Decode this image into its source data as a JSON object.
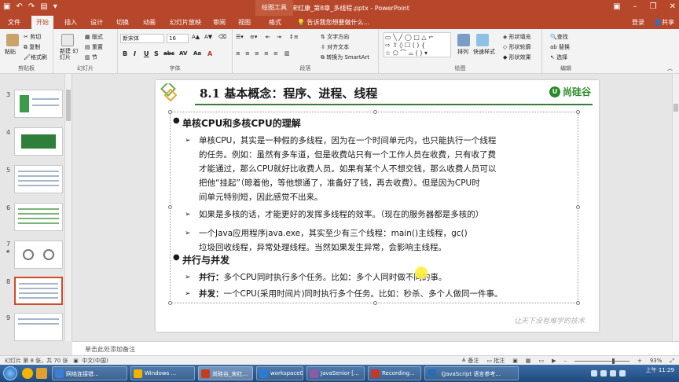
{
  "title_bar": {
    "title": "尚硅谷_宋红康_第8章_多线程.pptx - PowerPoint",
    "drawing_tools": "绘图工具",
    "qa_icons": [
      "save-icon",
      "undo-icon",
      "redo-icon",
      "start-from-beginning-icon",
      "customize-icon"
    ]
  },
  "ribbon_tabs": [
    "文件",
    "开始",
    "插入",
    "设计",
    "切换",
    "动画",
    "幻灯片放映",
    "审阅",
    "视图",
    "格式"
  ],
  "active_tab": "开始",
  "tell_me": "告诉我您想要做什么...",
  "account": {
    "login": "登录",
    "share": "共享"
  },
  "ribbon": {
    "clipboard": {
      "paste": "粘贴",
      "cut": "剪切",
      "copy": "复制",
      "format_painter": "格式刷",
      "label": "剪贴板"
    },
    "slides": {
      "new_slide": "新建\n幻灯片",
      "layout": "版式",
      "reset": "重置",
      "section": "节",
      "label": "幻灯片"
    },
    "font": {
      "name": "新宋体",
      "size": "16",
      "label": "字体",
      "buttons": [
        "B",
        "I",
        "U",
        "S",
        "abc",
        "AV",
        "Aa",
        "A"
      ]
    },
    "paragraph": {
      "text_direction": "文字方向",
      "align_text": "对齐文本",
      "smartart": "转换为 SmartArt",
      "label": "段落"
    },
    "drawing": {
      "arrange": "排列",
      "quick_styles": "快速样式",
      "shape_fill": "形状填充",
      "shape_outline": "形状轮廓",
      "shape_effects": "形状效果",
      "label": "绘图"
    },
    "editing": {
      "find": "查找",
      "replace": "替换",
      "select": "选择",
      "label": "编辑"
    }
  },
  "thumbnails": [
    {
      "num": "3",
      "selected": false,
      "starred": false
    },
    {
      "num": "4",
      "selected": false,
      "starred": false
    },
    {
      "num": "5",
      "selected": false,
      "starred": false
    },
    {
      "num": "6",
      "selected": false,
      "starred": false
    },
    {
      "num": "7",
      "selected": false,
      "starred": true
    },
    {
      "num": "8",
      "selected": true,
      "starred": false
    },
    {
      "num": "9",
      "selected": false,
      "starred": false
    }
  ],
  "slide": {
    "title": "8.1 基本概念：程序、进程、线程",
    "brand": "尚硅谷",
    "bullet1": "单核CPU和多核CPU的理解",
    "para1_lines": [
      "单核CPU，其实是一种假的多线程，因为在一个时间单元内，也只能执行一个线程",
      "的任务。例如：虽然有多车道，但是收费站只有一个工作人员在收费，只有收了费",
      "才能通过，那么CPU就好比收费人员。如果有某个人不想交钱，那么收费人员可以",
      "把他“挂起”（晾着他，等他想通了，准备好了钱，再去收费）。但是因为CPU时",
      "间单元特别短，因此感觉不出来。"
    ],
    "para2": "如果是多核的话，才能更好的发挥多线程的效率。（现在的服务器都是多核的）",
    "para3_lines": [
      "一个Java应用程序java.exe，其实至少有三个线程：main()主线程，gc()",
      "垃圾回收线程，异常处理线程。当然如果发生异常，会影响主线程。"
    ],
    "bullet2": "并行与并发",
    "parallel_label": "并行：",
    "parallel_text": "多个CPU同时执行多个任务。比如：多个人同时做不同的事。",
    "concurrent_label": "并发：",
    "concurrent_text": "一个CPU(采用时间片)同时执行多个任务。比如：秒杀、多个人做同一件事。",
    "watermark": "让天下没有难学的技术"
  },
  "notes": "单击此处添加备注",
  "status": {
    "slide": "幻灯片 第 8 张，共 70 张",
    "lang": "中文(中国)",
    "notes": "备注",
    "comments": "批注",
    "zoom": "93%"
  },
  "taskbar": {
    "items": [
      "网络连接错...",
      "Windows ...",
      "尚硅谷_宋红...",
      "workspace0...",
      "JavaSenior [...",
      "Recording...",
      "《JavaScript 语言参考..."
    ],
    "colors": [
      "#3b7dd8",
      "#f0b400",
      "#c43e1c",
      "#2a7bd6",
      "#8e5aa8",
      "#c0392b",
      "#2b6cb0"
    ],
    "active_index": 2,
    "clock_time": "上午 11:29"
  }
}
